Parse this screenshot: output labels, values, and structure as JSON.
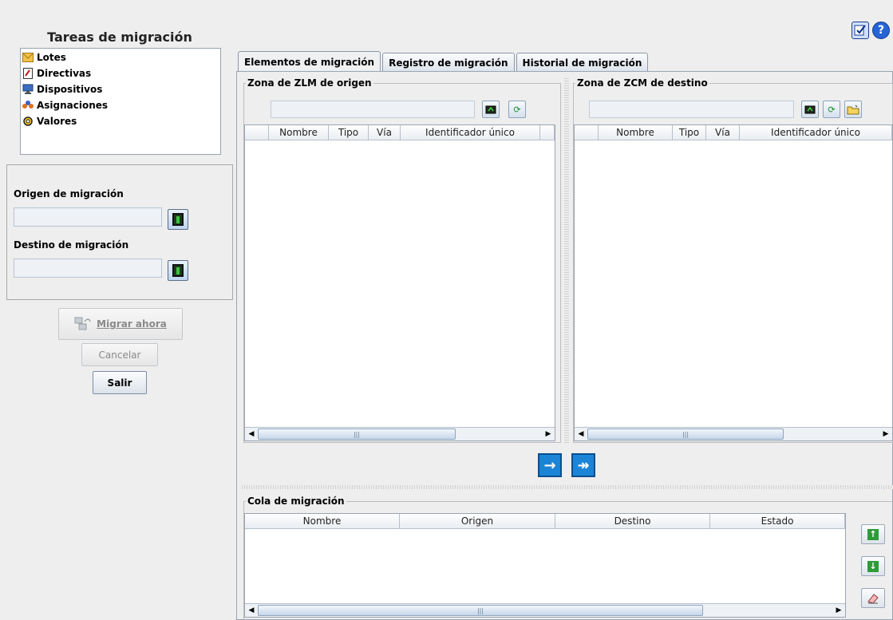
{
  "left_panel": {
    "title": "Tareas de migración",
    "tasks": [
      {
        "label": "Lotes",
        "icon": "bundle-icon"
      },
      {
        "label": "Directivas",
        "icon": "policy-icon"
      },
      {
        "label": "Dispositivos",
        "icon": "device-icon"
      },
      {
        "label": "Asignaciones",
        "icon": "assignment-icon"
      },
      {
        "label": "Valores",
        "icon": "settings-icon"
      }
    ],
    "source_label": "Origen de migración",
    "source_value": "",
    "target_label": "Destino de migración",
    "target_value": "",
    "migrate_now": "Migrar ahora",
    "cancel": "Cancelar",
    "exit": "Salir"
  },
  "tabs": [
    "Elementos de migración",
    "Registro de migración",
    "Historial de migración"
  ],
  "active_tab": 0,
  "source_zone": {
    "title": "Zona de ZLM de origen",
    "path_value": "",
    "columns": [
      "",
      "Nombre",
      "Tipo",
      "Vía",
      "Identificador único"
    ]
  },
  "target_zone": {
    "title": "Zona de ZCM de destino",
    "path_value": "",
    "columns": [
      "",
      "Nombre",
      "Tipo",
      "Vía",
      "Identificador único"
    ]
  },
  "queue": {
    "title": "Cola de migración",
    "columns": [
      "Nombre",
      "Origen",
      "Destino",
      "Estado"
    ]
  },
  "glyphs": {
    "move_one": "→",
    "move_all": "↠",
    "up": "↑",
    "down": "↓",
    "scroll_left": "◀",
    "scroll_right": "▶",
    "thumb": "|||",
    "refresh": "⟳",
    "help": "?"
  },
  "colors": {
    "accent_blue": "#1b84d6",
    "green_button": "#2e9b3a"
  }
}
